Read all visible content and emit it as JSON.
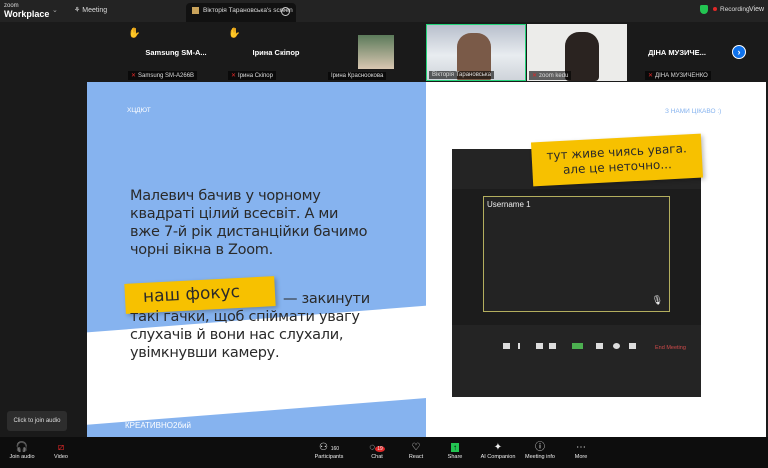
{
  "topbar": {
    "logo_small": "zoom",
    "logo": "Workplace",
    "meeting": "Meeting",
    "tab": "Вікторія Тарановська's screen",
    "recording": "Recording",
    "view": "View"
  },
  "participants": [
    {
      "name": "Samsung  SM-A...",
      "label": "Samsung SM-A266B",
      "hand": true
    },
    {
      "name": "Ірина Скіпор",
      "label": "Ірина Скіпор",
      "hand": true
    },
    {
      "label": "Ірина Красноокова"
    },
    {
      "label": "Вікторія Тарановська"
    },
    {
      "label": "zoom kedu"
    },
    {
      "name": "ДІНА  МУЗИЧЕ...",
      "label": "ДІНА МУЗИЧЕНКО"
    }
  ],
  "slide": {
    "brand": "ХЦДЮТ",
    "top_right": "З НАМИ ЦІКАВО :)",
    "main": [
      "Малевич бачив у чорному",
      "квадраті цілий всесвіт. А ми",
      "вже 7-й рік дистанційки бачимо",
      "чорні вікна в Zoom."
    ],
    "focus_tag": "наш фокус",
    "focus": [
      "— закинути",
      "такі гачки, щоб спіймати увагу",
      "слухачів й вони нас слухали,",
      "увімкнувши камеру."
    ],
    "callout": [
      "тут живе чиясь увага.",
      "але це неточно..."
    ],
    "username": "Username 1",
    "end_meeting": "End Meeting",
    "footer": "КРЕАТИВНО2бий"
  },
  "tooltip": "Click to join audio",
  "toolbar": {
    "join_audio": "Join audio",
    "video": "Video",
    "participants": "Participants",
    "participants_count": "160",
    "chat": "Chat",
    "chat_badge": "19",
    "react": "React",
    "share": "Share",
    "ai": "AI Companion",
    "info": "Meeting info",
    "more": "More"
  }
}
